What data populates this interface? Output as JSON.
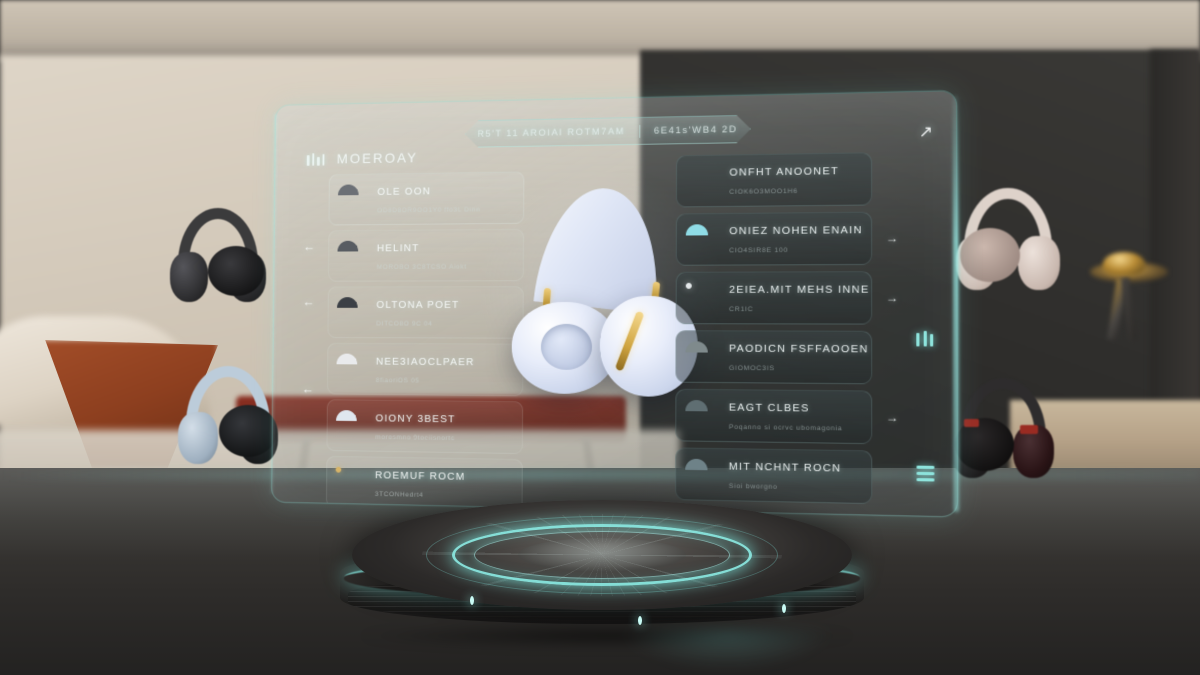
{
  "topbar": {
    "left_text": "R5'T 11 AROIAI ROTM7AM",
    "right_text": "6E41s'WB4 2D"
  },
  "header": {
    "title": "MOEROAY",
    "eq_icon": "equalizer-icon",
    "expand_icon": "arrow-up-right-icon"
  },
  "left_list": [
    {
      "title": "OLE OON",
      "subtitle": "OD8D8OR9OO1Y0 ffo3L Dinn",
      "icon": "headphones-icon",
      "color": "#6c7076",
      "accent": "#2f3337",
      "selected": true
    },
    {
      "title": "HELINT",
      "subtitle": "MOROBO 3C8TCSO Aiokt",
      "icon": "headphones-icon",
      "color": "#585c62",
      "accent": "#2a2d31",
      "selected": false
    },
    {
      "title": "OLTONA POET",
      "subtitle": "DITCO8O 9C 04",
      "icon": "headphones-icon",
      "color": "#3b3f45",
      "accent": "#17191c",
      "selected": false
    },
    {
      "title": "NEE3IAOCLPAER",
      "subtitle": "8fiaoriOS 05",
      "icon": "headphones-icon",
      "color": "#e9eaec",
      "accent": "#c3c6ca",
      "selected": false
    },
    {
      "title": "OIONY 3BEST",
      "subtitle": "morosmno 9toeiisnortc",
      "icon": "headphones-icon",
      "color": "#dfe6ee",
      "accent": "#b6c2cf",
      "selected": false
    },
    {
      "title": "ROEMUF ROCM",
      "subtitle": "3TCONHedrt4",
      "icon": "headphones-gold-icon",
      "color": "#d7b468",
      "accent": "#3a3228",
      "selected": false
    }
  ],
  "right_list": [
    {
      "title": "ONFHT ANOONET",
      "subtitle": "CIOK6O3MOO1H6",
      "icon": "headphones-icon",
      "color": "#c8bcae",
      "accent": "#3a3631",
      "arrow": ""
    },
    {
      "title": "ONIEZ NOHEN ENAIN",
      "subtitle": "CIO4SIR8E 100",
      "icon": "headphones-cyan-icon",
      "color": "#8fdce6",
      "accent": "#2a4a52",
      "arrow": "→"
    },
    {
      "title": "2EIEA.MIT MEHS INNE",
      "subtitle": "CR1IC",
      "icon": "headband-ring-icon",
      "color": "#e4e8ea",
      "accent": "#b9c0c4",
      "arrow": "→"
    },
    {
      "title": "PAODICN FSFFAOOEN",
      "subtitle": "GIOMOC3IS",
      "icon": "headphones-icon",
      "color": "#7f8a8c",
      "accent": "#343a3c",
      "arrow": ""
    },
    {
      "title": "EAGT CLBES",
      "subtitle": "Poqanno si ocrvc ubomagonia",
      "icon": "headphones-icon",
      "color": "#5f6e72",
      "accent": "#222b2e",
      "arrow": "→"
    },
    {
      "title": "MIT NCHNT ROCN",
      "subtitle": "Sioi bworgno",
      "icon": "headphones-icon",
      "color": "#6e8288",
      "accent": "#243034",
      "arrow": ""
    }
  ],
  "rail": {
    "eq_icon": "equalizer-icon",
    "menu_icon": "hamburger-menu-icon"
  },
  "back_arrows": [
    "←",
    "←",
    "←"
  ],
  "hero": {
    "name": "featured-headphones",
    "body_color": "#e8edfa",
    "accent_color": "#cfa440"
  },
  "podium": {
    "name": "display-turntable",
    "glow_color": "#8ceee4"
  },
  "room_products": [
    {
      "name": "floating-headphones-charcoal",
      "color": "#3b3b3c",
      "pad": "#1d1d1e"
    },
    {
      "name": "floating-headphones-silverblue",
      "color": "#b9c9d6",
      "pad": "#232528"
    },
    {
      "name": "floating-headphones-rosegold",
      "color": "#ddd0c9",
      "pad": "#c3b2a9"
    },
    {
      "name": "floating-headphones-blackred",
      "color": "#2d2b2c",
      "pad": "#1a1819"
    }
  ],
  "theme": {
    "accent_cyan": "#8ceee4",
    "panel_tint": "#8aa0a0",
    "text_primary": "#f6faf9"
  }
}
